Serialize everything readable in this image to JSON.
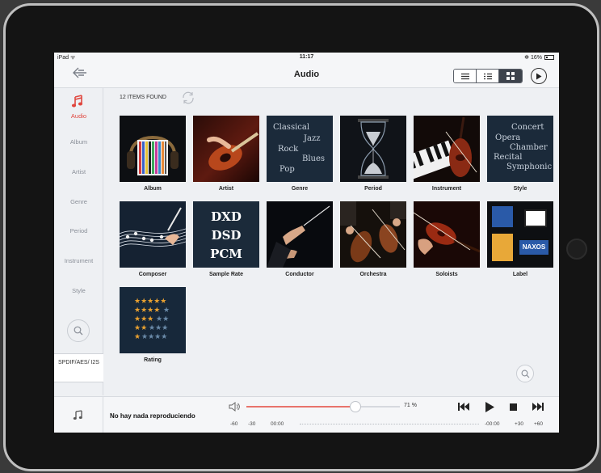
{
  "statusbar": {
    "carrier": "iPad ᯤ",
    "time": "11:17",
    "battery": "✻ 16%"
  },
  "navbar": {
    "title": "Audio"
  },
  "sidebar": {
    "items": [
      {
        "label": "Audio"
      },
      {
        "label": "Album"
      },
      {
        "label": "Artist"
      },
      {
        "label": "Genre"
      },
      {
        "label": "Period"
      },
      {
        "label": "Instrument"
      },
      {
        "label": "Style"
      }
    ],
    "output": "SPDIF/AES/ I2S"
  },
  "main": {
    "items_found": "12 ITEMS FOUND",
    "tiles": [
      {
        "label": "Album"
      },
      {
        "label": "Artist"
      },
      {
        "label": "Genre",
        "art_text": [
          "Classical",
          "Jazz",
          "Rock",
          "Blues",
          "Pop"
        ]
      },
      {
        "label": "Period"
      },
      {
        "label": "Instrument"
      },
      {
        "label": "Style",
        "art_text": [
          "Concert",
          "Opera",
          "Chamber",
          "Recital",
          "Symphonic"
        ]
      },
      {
        "label": "Composer"
      },
      {
        "label": "Sample Rate",
        "art_text": [
          "DXD",
          "DSD",
          "PCM"
        ]
      },
      {
        "label": "Conductor"
      },
      {
        "label": "Orchestra"
      },
      {
        "label": "Soloists"
      },
      {
        "label": "Label",
        "art_text": [
          "NAXOS"
        ]
      },
      {
        "label": "Rating"
      }
    ]
  },
  "player": {
    "now_playing": "No hay nada reproduciendo",
    "volume_value": 71,
    "volume_text": "71 %",
    "skip_back": [
      "-60",
      "-30"
    ],
    "elapsed": "00:00",
    "remaining": "-00:00",
    "skip_fwd": [
      "+30",
      "+60"
    ]
  },
  "colors": {
    "accent": "#e0463e",
    "tile_bg": "#111418"
  },
  "icons": [
    "back-arrow-icon",
    "list-view-icon",
    "detail-view-icon",
    "grid-view-icon",
    "play-circle-icon",
    "music-note-icon",
    "search-icon",
    "refresh-icon",
    "speaker-icon",
    "skip-previous-icon",
    "play-icon",
    "stop-icon",
    "skip-next-icon"
  ]
}
